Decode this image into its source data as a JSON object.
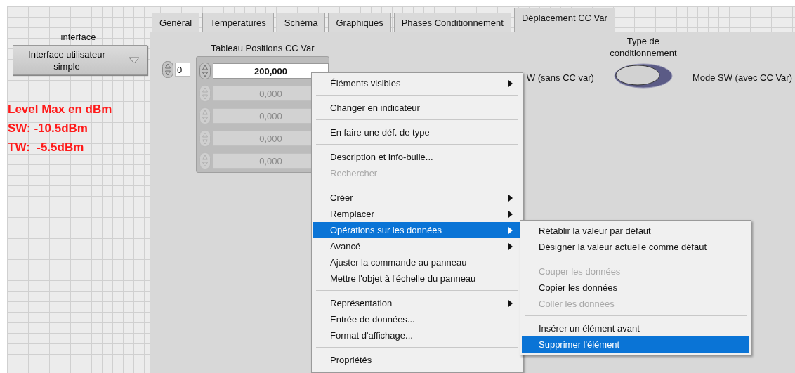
{
  "left_panel": {
    "label": "interface",
    "dropdown": {
      "value": "Interface utilisateur simple"
    },
    "notes": [
      "Level Max en dBm",
      "SW: -10.5dBm",
      "TW:  -5.5dBm"
    ]
  },
  "tabs": [
    {
      "label": "Général",
      "selected": false
    },
    {
      "label": "Températures",
      "selected": false
    },
    {
      "label": "Schéma",
      "selected": false
    },
    {
      "label": "Graphiques",
      "selected": false
    },
    {
      "label": "Phases Conditionnement",
      "selected": false
    },
    {
      "label": "Déplacement CC Var",
      "selected": true
    }
  ],
  "array": {
    "label": "Tableau Positions CC Var",
    "index": "0",
    "elements": [
      {
        "value": "200,000",
        "disabled": false
      },
      {
        "value": "0,000",
        "disabled": true
      },
      {
        "value": "0,000",
        "disabled": true
      },
      {
        "value": "0,000",
        "disabled": true
      },
      {
        "value": "0,000",
        "disabled": true
      }
    ]
  },
  "toggle": {
    "label": "Type de conditionnement",
    "off_label": "W (sans CC var)",
    "on_label": "Mode SW (avec CC Var)",
    "on": false
  },
  "context_menu": {
    "items": [
      {
        "kind": "item",
        "label": "Éléments visibles",
        "submenu": true,
        "disabled": false,
        "selected": false
      },
      {
        "kind": "separator"
      },
      {
        "kind": "item",
        "label": "Changer en indicateur",
        "submenu": false,
        "disabled": false,
        "selected": false
      },
      {
        "kind": "separator"
      },
      {
        "kind": "item",
        "label": "En faire une déf. de type",
        "submenu": false,
        "disabled": false,
        "selected": false
      },
      {
        "kind": "separator"
      },
      {
        "kind": "item",
        "label": "Description et info-bulle...",
        "submenu": false,
        "disabled": false,
        "selected": false
      },
      {
        "kind": "item",
        "label": "Rechercher",
        "submenu": false,
        "disabled": true,
        "selected": false
      },
      {
        "kind": "separator"
      },
      {
        "kind": "item",
        "label": "Créer",
        "submenu": true,
        "disabled": false,
        "selected": false
      },
      {
        "kind": "item",
        "label": "Remplacer",
        "submenu": true,
        "disabled": false,
        "selected": false
      },
      {
        "kind": "item",
        "label": "Opérations sur les données",
        "submenu": true,
        "disabled": false,
        "selected": true
      },
      {
        "kind": "item",
        "label": "Avancé",
        "submenu": true,
        "disabled": false,
        "selected": false
      },
      {
        "kind": "item",
        "label": "Ajuster la commande au panneau",
        "submenu": false,
        "disabled": false,
        "selected": false
      },
      {
        "kind": "item",
        "label": "Mettre l'objet à l'échelle du panneau",
        "submenu": false,
        "disabled": false,
        "selected": false
      },
      {
        "kind": "separator"
      },
      {
        "kind": "item",
        "label": "Représentation",
        "submenu": true,
        "disabled": false,
        "selected": false
      },
      {
        "kind": "item",
        "label": "Entrée de données...",
        "submenu": false,
        "disabled": false,
        "selected": false
      },
      {
        "kind": "item",
        "label": "Format d'affichage...",
        "submenu": false,
        "disabled": false,
        "selected": false
      },
      {
        "kind": "separator"
      },
      {
        "kind": "item",
        "label": "Propriétés",
        "submenu": false,
        "disabled": false,
        "selected": false
      }
    ]
  },
  "submenu": {
    "items": [
      {
        "kind": "item",
        "label": "Rétablir la valeur par défaut",
        "submenu": false,
        "disabled": false,
        "selected": false
      },
      {
        "kind": "item",
        "label": "Désigner la valeur actuelle comme défaut",
        "submenu": false,
        "disabled": false,
        "selected": false
      },
      {
        "kind": "separator"
      },
      {
        "kind": "item",
        "label": "Couper les données",
        "submenu": false,
        "disabled": true,
        "selected": false
      },
      {
        "kind": "item",
        "label": "Copier les données",
        "submenu": false,
        "disabled": false,
        "selected": false
      },
      {
        "kind": "item",
        "label": "Coller les données",
        "submenu": false,
        "disabled": true,
        "selected": false
      },
      {
        "kind": "separator"
      },
      {
        "kind": "item",
        "label": "Insérer un élément avant",
        "submenu": false,
        "disabled": false,
        "selected": false
      },
      {
        "kind": "item",
        "label": "Supprimer l'élément",
        "submenu": false,
        "disabled": false,
        "selected": true
      }
    ]
  }
}
